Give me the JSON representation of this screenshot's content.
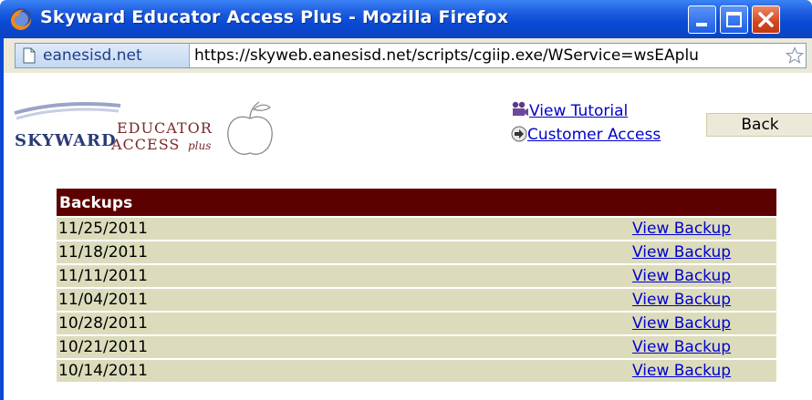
{
  "window": {
    "title": "Skyward Educator Access Plus - Mozilla Firefox",
    "icon": "firefox-icon"
  },
  "address_bar": {
    "site_name": "eanesisd.net",
    "url": "https://skyweb.eanesisd.net/scripts/cgiip.exe/WService=wsEAplu"
  },
  "header": {
    "logo_text_1": "EDUCATOR",
    "logo_text_2": "ACCESS",
    "logo_text_3": "plus",
    "logo_brand": "SKYWARD",
    "view_tutorial": "View Tutorial",
    "customer_access": "Customer Access",
    "back_label": "Back"
  },
  "backups": {
    "heading": "Backups",
    "rows": [
      {
        "date": "11/25/2011",
        "action": "View Backup"
      },
      {
        "date": "11/18/2011",
        "action": "View Backup"
      },
      {
        "date": "11/11/2011",
        "action": "View Backup"
      },
      {
        "date": "11/04/2011",
        "action": "View Backup"
      },
      {
        "date": "10/28/2011",
        "action": "View Backup"
      },
      {
        "date": "10/21/2011",
        "action": "View Backup"
      },
      {
        "date": "10/14/2011",
        "action": "View Backup"
      }
    ]
  },
  "colors": {
    "titlebar": "#0a4ad4",
    "table_header": "#5c0000",
    "row_bg": "#dcdcbc",
    "link": "#0000cc"
  }
}
